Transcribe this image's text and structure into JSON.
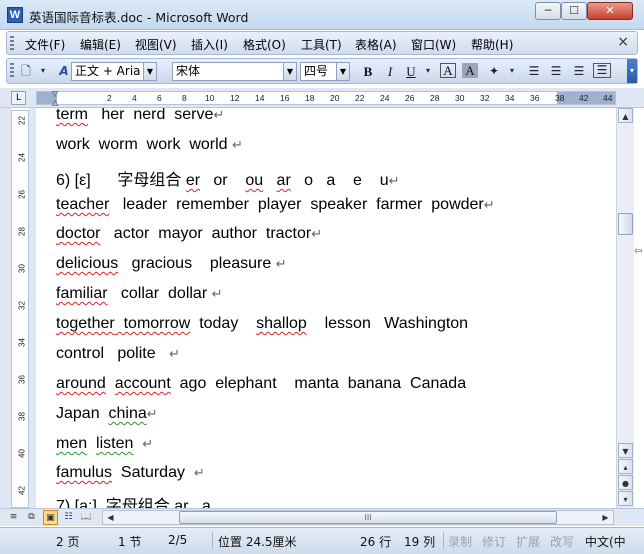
{
  "window": {
    "title": "英语国际音标表.doc - Microsoft Word",
    "min": "─",
    "max": "☐",
    "close": "✕"
  },
  "menu": {
    "items": [
      "文件(F)",
      "编辑(E)",
      "视图(V)",
      "插入(I)",
      "格式(O)",
      "工具(T)",
      "表格(A)",
      "窗口(W)",
      "帮助(H)"
    ],
    "close": "×"
  },
  "toolbar": {
    "style_value": "正文 + Aria",
    "font_value": "宋体",
    "size_value": "四号",
    "bold": "B",
    "italic": "I",
    "underline": "U",
    "char_border": "A",
    "char_shade": "A"
  },
  "ruler": {
    "numbers": [
      "2",
      "4",
      "6",
      "8",
      "10",
      "12",
      "14",
      "16",
      "18",
      "20",
      "22",
      "24",
      "26",
      "28",
      "30",
      "32",
      "34",
      "36",
      "38",
      "42",
      "44"
    ]
  },
  "vruler": {
    "numbers": [
      "22",
      "24",
      "26",
      "28",
      "30",
      "32",
      "34",
      "36",
      "38",
      "40",
      "42"
    ]
  },
  "document": {
    "lines": [
      [
        "term",
        "   her  nerd  serve"
      ],
      [
        "work  worm  work  world "
      ],
      [
        "6) [ε]      字母组合 ",
        "er",
        "   or    ",
        "ou",
        "   ",
        "ar",
        "   o   a    e    u"
      ],
      [
        "teacher",
        "   leader  remember  player  speaker  farmer  powder"
      ],
      [
        "doctor",
        "   actor  mayor  author  tractor"
      ],
      [
        "delicious",
        "   gracious    pleasure "
      ],
      [
        "familiar",
        "   collar  dollar "
      ],
      [
        "together",
        "  tomorrow",
        "  today    ",
        "shallop",
        "    lesson   Washington"
      ],
      [
        "control",
        "   polite   "
      ],
      [
        "around",
        "  ",
        "account",
        "  ago  elephant    manta  banana  Canada"
      ],
      [
        "Japan",
        "  ",
        "china"
      ],
      [
        "men",
        "  ",
        "listen",
        "  "
      ],
      [
        "famulus",
        "  Saturday  "
      ],
      [
        "7) [a:]  字母组合 ",
        "ar",
        "   a"
      ]
    ]
  },
  "status": {
    "page": "2 页",
    "section": "1 节",
    "pages": "2/5",
    "position": "位置 24.5厘米",
    "line": "26 行",
    "column": "19 列",
    "rec": "录制",
    "trk": "修订",
    "ext": "扩展",
    "ovr": "改写",
    "lang": "中文(中"
  },
  "hscroll_thumb": "III"
}
